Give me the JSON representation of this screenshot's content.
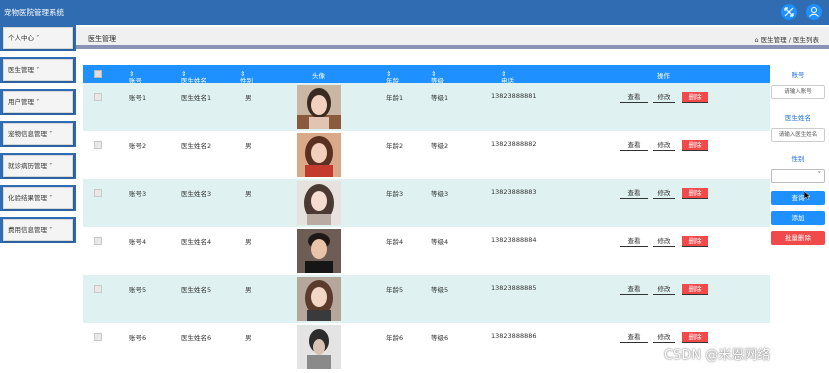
{
  "app": {
    "title": "宠物医院管理系统"
  },
  "topbar_icons": [
    "expand-icon",
    "user-icon"
  ],
  "sidebar": {
    "items": [
      {
        "label": "个人中心"
      },
      {
        "label": "医生管理"
      },
      {
        "label": "用户管理"
      },
      {
        "label": "宠物信息管理"
      },
      {
        "label": "就诊病历管理"
      },
      {
        "label": "化验结果管理"
      },
      {
        "label": "费用信息管理"
      }
    ]
  },
  "page": {
    "title": "医生管理",
    "breadcrumb": "医生管理 / 医生列表"
  },
  "table": {
    "headers": [
      "账号",
      "医生姓名",
      "性别",
      "头像",
      "年龄",
      "等级",
      "电话",
      "操作"
    ],
    "rows": [
      {
        "account": "账号1",
        "name": "医生姓名1",
        "gender": "男",
        "age": "年龄1",
        "level": "等级1",
        "phone": "13823888881"
      },
      {
        "account": "账号2",
        "name": "医生姓名2",
        "gender": "男",
        "age": "年龄2",
        "level": "等级2",
        "phone": "13823888882"
      },
      {
        "account": "账号3",
        "name": "医生姓名3",
        "gender": "男",
        "age": "年龄3",
        "level": "等级3",
        "phone": "13823888883"
      },
      {
        "account": "账号4",
        "name": "医生姓名4",
        "gender": "男",
        "age": "年龄4",
        "level": "等级4",
        "phone": "13823888884"
      },
      {
        "account": "账号5",
        "name": "医生姓名5",
        "gender": "男",
        "age": "年龄5",
        "level": "等级5",
        "phone": "13823888885"
      },
      {
        "account": "账号6",
        "name": "医生姓名6",
        "gender": "男",
        "age": "年龄6",
        "level": "等级6",
        "phone": "13823888886"
      }
    ],
    "actions": {
      "view": "查看",
      "edit": "修改",
      "delete": "删除"
    }
  },
  "search": {
    "account_label": "账号",
    "account_placeholder": "请输入账号",
    "name_label": "医生姓名",
    "name_placeholder": "请输入医生姓名",
    "gender_label": "性别",
    "query_button": "查询",
    "add_button": "添加",
    "batch_delete_button": "批量删除"
  },
  "watermark": "CSDN @米恩网络",
  "colors": {
    "topbar": "#2f6cb1",
    "table_header": "#1e90ff",
    "row_alt": "#dff2f1",
    "delete": "#f04a4a",
    "batch_delete": "#f04a4a"
  }
}
